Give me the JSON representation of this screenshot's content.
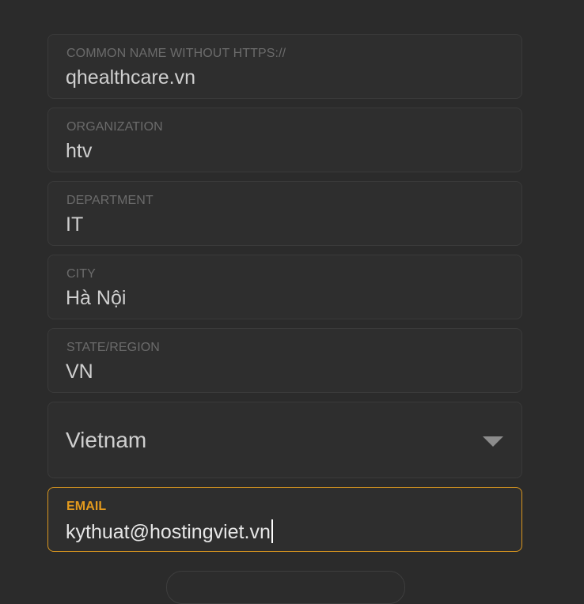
{
  "form": {
    "common_name": {
      "label": "COMMON NAME WITHOUT HTTPS://",
      "value": "qhealthcare.vn"
    },
    "organization": {
      "label": "ORGANIZATION",
      "value": "htv"
    },
    "department": {
      "label": "DEPARTMENT",
      "value": "IT"
    },
    "city": {
      "label": "CITY",
      "value": "Hà Nội"
    },
    "state": {
      "label": "STATE/REGION",
      "value": "VN"
    },
    "country": {
      "selected": "Vietnam"
    },
    "email": {
      "label": "EMAIL",
      "value": "kythuat@hostingviet.vn"
    }
  },
  "colors": {
    "background": "#2b2b2b",
    "field_background": "#2e2e2e",
    "label": "#6b6b6b",
    "value": "#cfcfcf",
    "focus_accent": "#e39a1d"
  },
  "icons": [
    "chevron-down-icon"
  ]
}
